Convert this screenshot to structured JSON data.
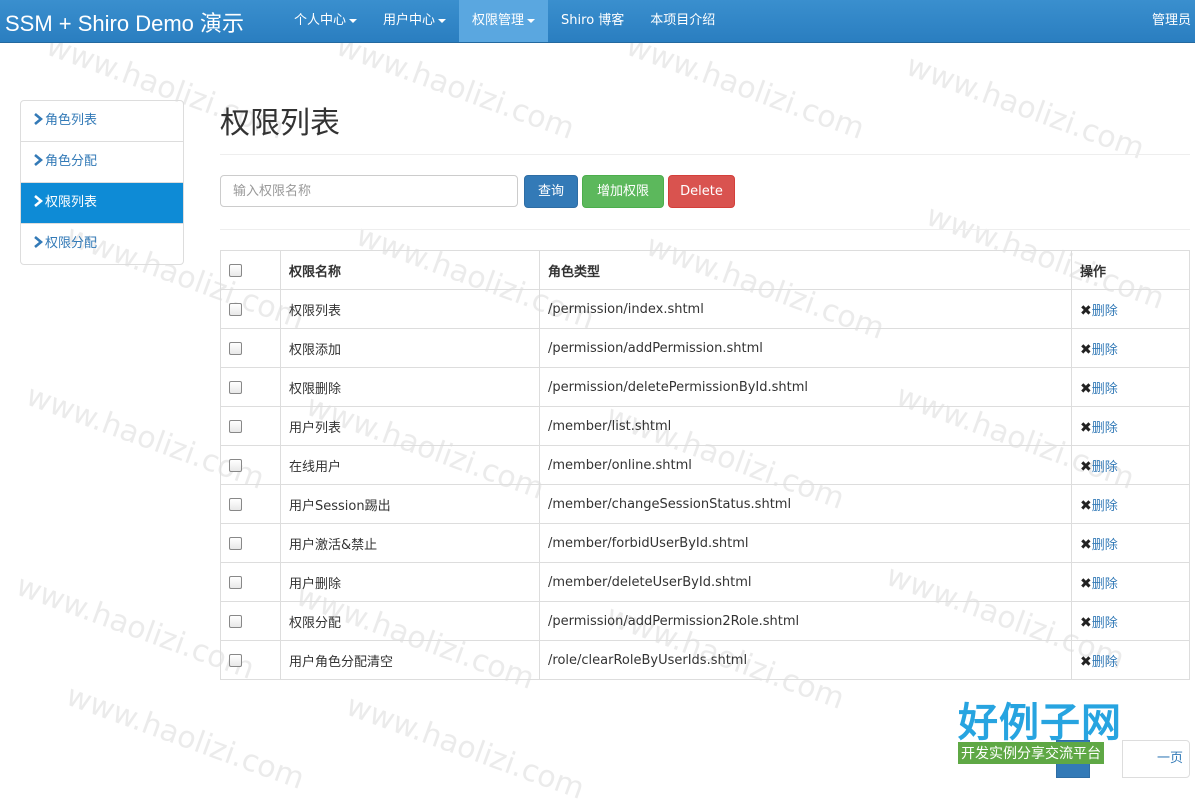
{
  "brand": "SSM + Shiro Demo 演示",
  "nav": {
    "items": [
      {
        "label": "个人中心",
        "dropdown": true,
        "active": false
      },
      {
        "label": "用户中心",
        "dropdown": true,
        "active": false
      },
      {
        "label": "权限管理",
        "dropdown": true,
        "active": true
      },
      {
        "label": "Shiro 博客",
        "dropdown": false,
        "active": false
      },
      {
        "label": "本项目介绍",
        "dropdown": false,
        "active": false
      }
    ],
    "user": "管理员"
  },
  "sidebar": {
    "items": [
      {
        "label": "角色列表",
        "active": false
      },
      {
        "label": "角色分配",
        "active": false
      },
      {
        "label": "权限列表",
        "active": true
      },
      {
        "label": "权限分配",
        "active": false
      }
    ]
  },
  "page": {
    "title": "权限列表"
  },
  "toolbar": {
    "search_placeholder": "输入权限名称",
    "query_label": "查询",
    "add_label": "增加权限",
    "delete_label": "Delete"
  },
  "table": {
    "headers": [
      "权限名称",
      "角色类型",
      "操作"
    ],
    "delete_label": "删除",
    "rows": [
      {
        "name": "权限列表",
        "url": "/permission/index.shtml"
      },
      {
        "name": "权限添加",
        "url": "/permission/addPermission.shtml"
      },
      {
        "name": "权限删除",
        "url": "/permission/deletePermissionById.shtml"
      },
      {
        "name": "用户列表",
        "url": "/member/list.shtml"
      },
      {
        "name": "在线用户",
        "url": "/member/online.shtml"
      },
      {
        "name": "用户Session踢出",
        "url": "/member/changeSessionStatus.shtml"
      },
      {
        "name": "用户激活&禁止",
        "url": "/member/forbidUserById.shtml"
      },
      {
        "name": "用户删除",
        "url": "/member/deleteUserById.shtml"
      },
      {
        "name": "权限分配",
        "url": "/permission/addPermission2Role.shtml"
      },
      {
        "name": "用户角色分配清空",
        "url": "/role/clearRoleByUserIds.shtml"
      }
    ]
  },
  "pagination": {
    "next_label": "一页"
  },
  "watermark": "www.haolizi.com",
  "logo": {
    "main": "好例子网",
    "sub": "开发实例分享交流平台"
  },
  "colors": {
    "navbar": "#2a7ec0",
    "sidebar_active": "#0e8bd6",
    "primary": "#337ab7",
    "success": "#5cb85c",
    "danger": "#d9534f"
  }
}
